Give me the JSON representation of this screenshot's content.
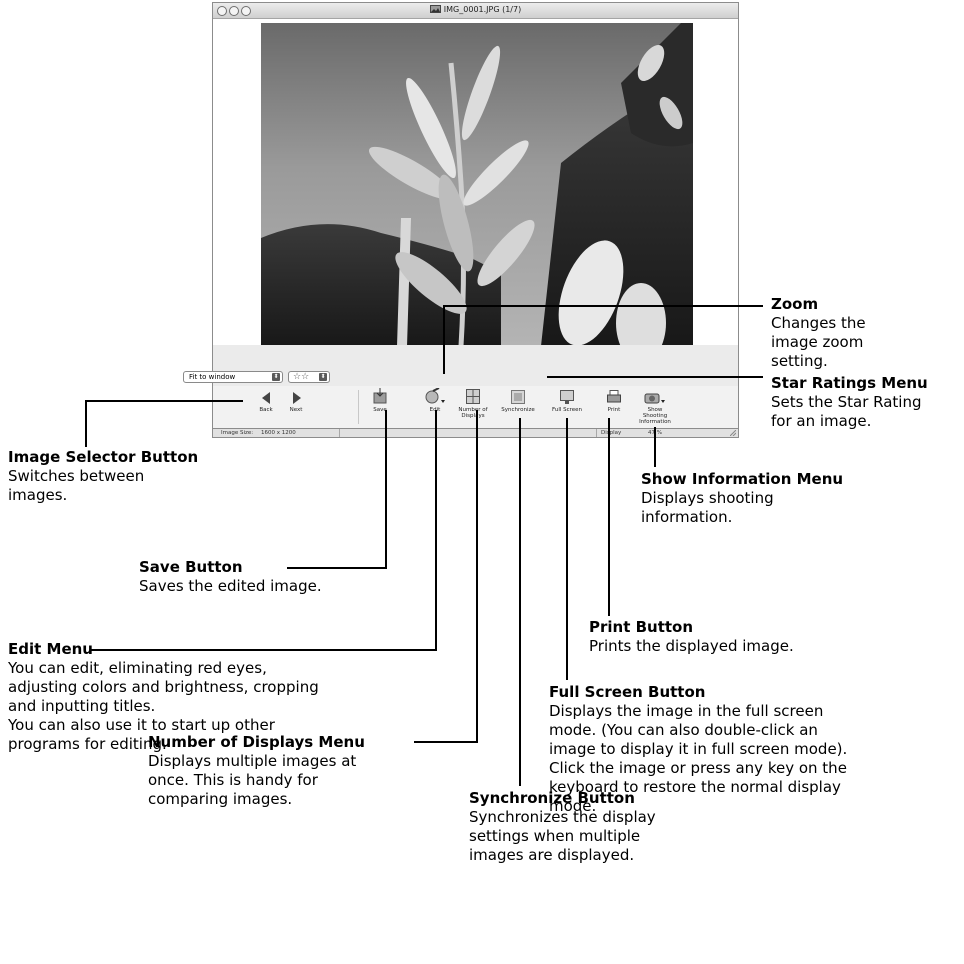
{
  "window": {
    "title": "IMG_0001.JPG (1/7)",
    "zoom_value": "Fit to window",
    "star_value": "☆☆"
  },
  "toolbar": {
    "back": "Back",
    "next": "Next",
    "save": "Save",
    "edit": "Edit",
    "number_of_displays": "Number of Displays",
    "synchronize": "Synchronize",
    "full_screen": "Full Screen",
    "print": "Print",
    "show_shooting_information": "Show Shooting Information"
  },
  "statusbar": {
    "image_size_label": "Image Size:",
    "image_size_value": "1600 x 1200",
    "display_label": "Display",
    "display_value": "47 %"
  },
  "callouts": {
    "zoom": {
      "title": "Zoom",
      "desc": "Changes the\nimage zoom\nsetting."
    },
    "star_ratings": {
      "title": "Star Ratings Menu",
      "desc": "Sets the Star Rating\nfor an image."
    },
    "image_selector": {
      "title": "Image Selector Button",
      "desc": "Switches between\nimages."
    },
    "show_information": {
      "title": "Show Information Menu",
      "desc": "Displays shooting\ninformation."
    },
    "save": {
      "title": "Save Button",
      "desc": "Saves the edited image."
    },
    "print": {
      "title": "Print Button",
      "desc": "Prints the displayed image."
    },
    "edit": {
      "title": "Edit Menu",
      "desc": "You can edit, eliminating red eyes,\nadjusting colors and brightness, cropping\nand inputting titles.\nYou can also use it to start up other\nprograms for editing."
    },
    "full_screen": {
      "title": "Full Screen Button",
      "desc": "Displays the image in the full screen\nmode. (You can also double-click an\nimage to display it in full screen mode).\nClick the image or press any key on the\nkeyboard to restore the normal display\nmode."
    },
    "number_of_displays": {
      "title": "Number of Displays Menu",
      "desc": "Displays multiple images at\nonce. This is handy for\ncomparing images."
    },
    "synchronize": {
      "title": "Synchronize Button",
      "desc": "Synchronizes the display\nsettings when multiple\nimages are displayed."
    }
  }
}
